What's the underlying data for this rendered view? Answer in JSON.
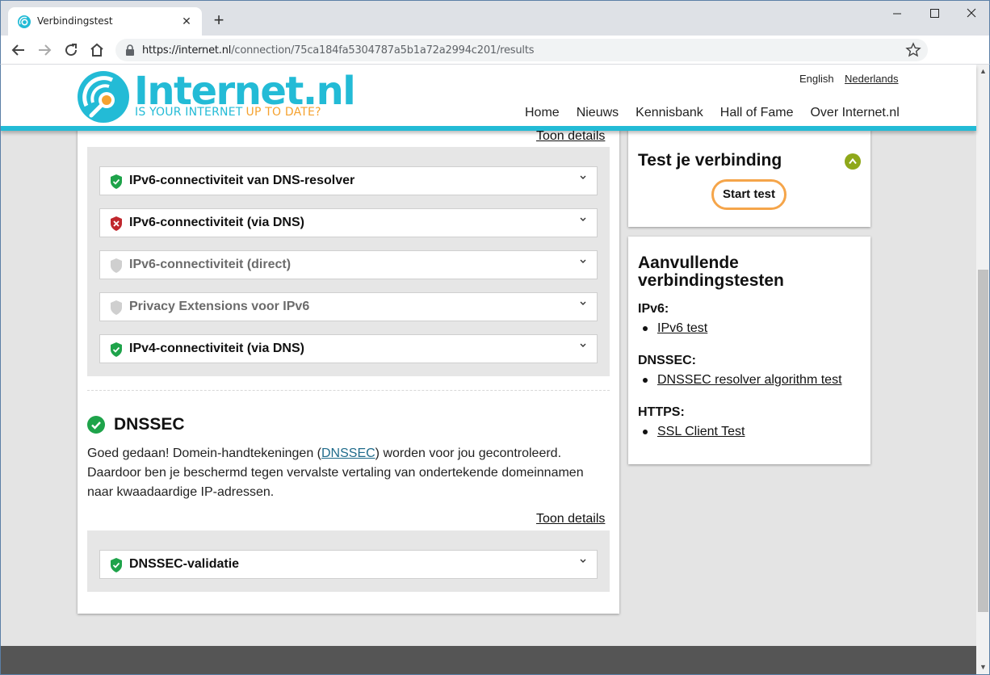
{
  "browser": {
    "tab_title": "Verbindingstest",
    "url_host": "https://internet.nl",
    "url_path": "/connection/75ca184fa5304787a5b1a72a2994c201/results"
  },
  "site": {
    "logo_name": "Internet.nl",
    "logo_tag_1": "IS YOUR INTERNET",
    "logo_tag_2": "UP TO DATE?",
    "lang_en": "English",
    "lang_nl": "Nederlands",
    "nav": [
      "Home",
      "Nieuws",
      "Kennisbank",
      "Hall of Fame",
      "Over Internet.nl"
    ],
    "brand_color": "#23bbd6",
    "accent_color": "#f5a230"
  },
  "main": {
    "toon_details_top": "Toon details",
    "ipv6_tests": [
      {
        "label": "IPv6-connectiviteit van DNS-resolver",
        "status": "pass"
      },
      {
        "label": "IPv6-connectiviteit (via DNS)",
        "status": "fail"
      },
      {
        "label": "IPv6-connectiviteit (direct)",
        "status": "neutral"
      },
      {
        "label": "Privacy Extensions voor IPv6",
        "status": "neutral"
      },
      {
        "label": "IPv4-connectiviteit (via DNS)",
        "status": "pass"
      }
    ],
    "dnssec": {
      "title": "DNSSEC",
      "body_1": "Goed gedaan! Domein-handtekeningen (",
      "body_link": "DNSSEC",
      "body_2": ") worden voor jou gecontroleerd.",
      "body_3": "Daardoor ben je beschermd tegen vervalste vertaling van ondertekende domeinnamen",
      "body_4": "naar kwaadaardige IP-adressen.",
      "toon_details": "Toon details",
      "tests": [
        {
          "label": "DNSSEC-validatie",
          "status": "pass"
        }
      ]
    }
  },
  "sidebar": {
    "test_title": "Test je verbinding",
    "start_button": "Start test",
    "extra_title": "Aanvullende verbindingstesten",
    "groups": [
      {
        "label": "IPv6:",
        "link": "IPv6 test"
      },
      {
        "label": "DNSSEC:",
        "link": "DNSSEC resolver algorithm test"
      },
      {
        "label": "HTTPS:",
        "link": "SSL Client Test"
      }
    ]
  },
  "status_colors": {
    "pass": "#1ea34a",
    "fail": "#c0272d",
    "neutral": "#c8c8c8"
  }
}
